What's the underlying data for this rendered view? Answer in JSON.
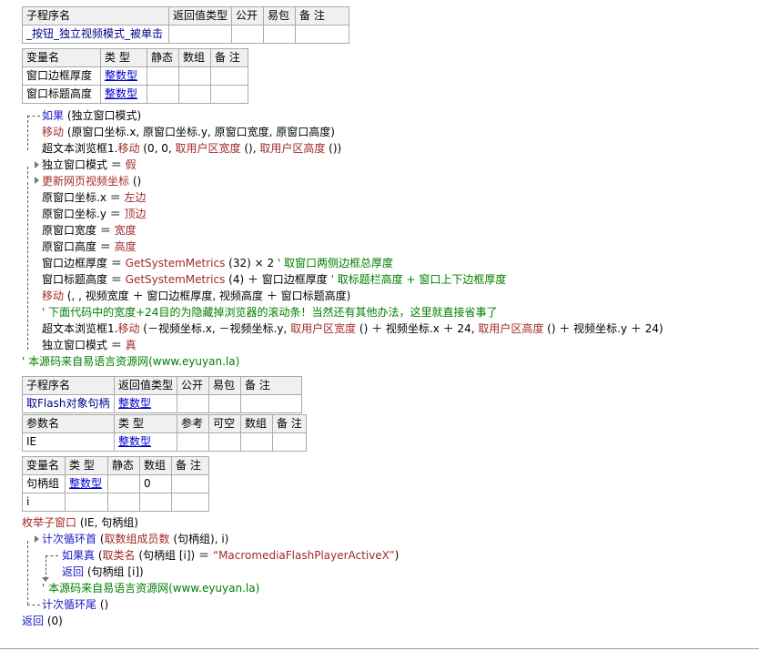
{
  "sub1": {
    "headers": [
      "子程序名",
      "返回值类型",
      "公开",
      "易包",
      "备 注"
    ],
    "name": "_按钮_独立视频模式_被单击"
  },
  "vars1": {
    "headers": [
      "变量名",
      "类 型",
      "静态",
      "数组",
      "备 注"
    ],
    "rows": [
      {
        "name": "窗口边框厚度",
        "type": "整数型"
      },
      {
        "name": "窗口标题高度",
        "type": "整数型"
      }
    ]
  },
  "code1": [
    "如果 (独立窗口模式)",
    "移动 (原窗口坐标.x, 原窗口坐标.y, 原窗口宽度, 原窗口高度)",
    "超文本浏览框1.移动 (0, 0, 取用户区宽度 (), 取用户区高度 ())",
    "独立窗口模式 ＝ 假",
    "更新网页视频坐标 ()",
    "原窗口坐标.x ＝ 左边",
    "原窗口坐标.y ＝ 顶边",
    "原窗口宽度 ＝ 宽度",
    "原窗口高度 ＝ 高度",
    "窗口边框厚度 ＝ GetSystemMetrics (32) × 2  ' 取窗口两侧边框总厚度",
    "窗口标题高度 ＝ GetSystemMetrics (4) ＋ 窗口边框厚度  ' 取标题栏高度 + 窗口上下边框厚度",
    "移动 (, , 视频宽度 ＋ 窗口边框厚度, 视频高度 ＋ 窗口标题高度)",
    "' 下面代码中的宽度+24目的为隐藏掉浏览器的滚动条！当然还有其他办法，这里就直接省事了",
    "超文本浏览框1.移动 (－视频坐标.x, －视频坐标.y, 取用户区宽度 () ＋ 视频坐标.x ＋ 24, 取用户区高度 () ＋ 视频坐标.y ＋ 24)",
    "独立窗口模式 ＝ 真",
    "' 本源码来自易语言资源网(www.eyuyan.la)"
  ],
  "sub2": {
    "headers": [
      "子程序名",
      "返回值类型",
      "公开",
      "易包",
      "备 注"
    ],
    "name": "取Flash对象句柄",
    "ret": "整数型",
    "param_headers": [
      "参数名",
      "类 型",
      "参考",
      "可空",
      "数组",
      "备 注"
    ],
    "param": {
      "name": "IE",
      "type": "整数型"
    }
  },
  "vars2": {
    "headers": [
      "变量名",
      "类 型",
      "静态",
      "数组",
      "备 注"
    ],
    "rows": [
      {
        "name": "句柄组",
        "type": "整数型",
        "array": "0"
      },
      {
        "name": "i",
        "type": "",
        "array": ""
      }
    ]
  },
  "code2": [
    "枚举子窗口 (IE, 句柄组)",
    "计次循环首 (取数组成员数 (句柄组), i)",
    "如果真 (取类名 (句柄组 [i]) ＝ “MacromediaFlashPlayerActiveX”)",
    "返回 (句柄组 [i])",
    "' 本源码来自易语言资源网(www.eyuyan.la)",
    "计次循环尾 ()",
    "返回 (0)"
  ]
}
